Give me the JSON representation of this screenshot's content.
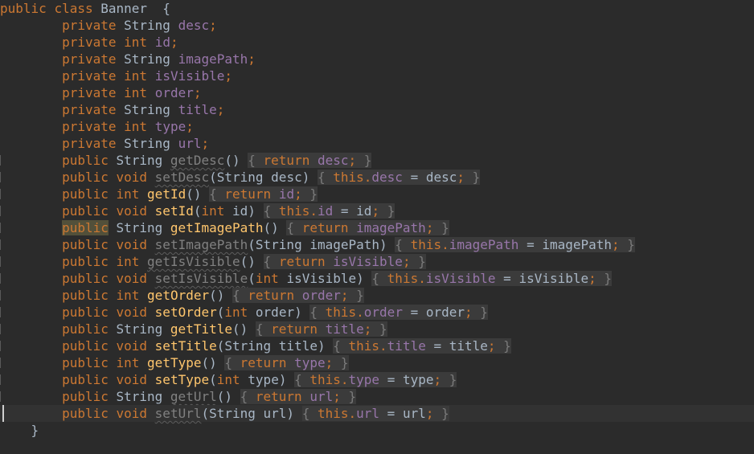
{
  "editor": {
    "lines": [
      {
        "indent": "",
        "tokens": [
          [
            "kw",
            "public"
          ],
          [
            "p",
            " "
          ],
          [
            "kw",
            "class"
          ],
          [
            "p",
            " Banner  {"
          ]
        ]
      },
      {
        "indent": "        ",
        "tokens": [
          [
            "kw",
            "private"
          ],
          [
            "p",
            " String "
          ],
          [
            "field",
            "desc"
          ],
          [
            "kw",
            ";"
          ]
        ]
      },
      {
        "indent": "        ",
        "tokens": [
          [
            "kw",
            "private"
          ],
          [
            "p",
            " "
          ],
          [
            "kw",
            "int"
          ],
          [
            "p",
            " "
          ],
          [
            "field",
            "id"
          ],
          [
            "kw",
            ";"
          ]
        ]
      },
      {
        "indent": "        ",
        "tokens": [
          [
            "kw",
            "private"
          ],
          [
            "p",
            " String "
          ],
          [
            "field",
            "imagePath"
          ],
          [
            "kw",
            ";"
          ]
        ]
      },
      {
        "indent": "        ",
        "tokens": [
          [
            "kw",
            "private"
          ],
          [
            "p",
            " "
          ],
          [
            "kw",
            "int"
          ],
          [
            "p",
            " "
          ],
          [
            "field",
            "isVisible"
          ],
          [
            "kw",
            ";"
          ]
        ]
      },
      {
        "indent": "        ",
        "tokens": [
          [
            "kw",
            "private"
          ],
          [
            "p",
            " "
          ],
          [
            "kw",
            "int"
          ],
          [
            "p",
            " "
          ],
          [
            "field",
            "order"
          ],
          [
            "kw",
            ";"
          ]
        ]
      },
      {
        "indent": "        ",
        "tokens": [
          [
            "kw",
            "private"
          ],
          [
            "p",
            " String "
          ],
          [
            "field",
            "title"
          ],
          [
            "kw",
            ";"
          ]
        ]
      },
      {
        "indent": "        ",
        "tokens": [
          [
            "kw",
            "private"
          ],
          [
            "p",
            " "
          ],
          [
            "kw",
            "int"
          ],
          [
            "p",
            " "
          ],
          [
            "field",
            "type"
          ],
          [
            "kw",
            ";"
          ]
        ]
      },
      {
        "indent": "        ",
        "tokens": [
          [
            "kw",
            "private"
          ],
          [
            "p",
            " String "
          ],
          [
            "field",
            "url"
          ],
          [
            "kw",
            ";"
          ]
        ]
      },
      {
        "indent": "        ",
        "tick": true,
        "tokens": [
          [
            "kw",
            "public"
          ],
          [
            "p",
            " String "
          ],
          [
            "unused",
            "getDesc"
          ],
          [
            "p",
            "() "
          ],
          [
            "foldp",
            "{ "
          ],
          [
            "foldk",
            "return"
          ],
          [
            "foldf",
            " desc"
          ],
          [
            "foldk",
            ";"
          ],
          [
            "foldp",
            " }"
          ]
        ]
      },
      {
        "indent": "        ",
        "tick": true,
        "tokens": [
          [
            "kw",
            "public"
          ],
          [
            "p",
            " "
          ],
          [
            "kw",
            "void"
          ],
          [
            "p",
            " "
          ],
          [
            "unused",
            "setDesc"
          ],
          [
            "p",
            "(String desc) "
          ],
          [
            "foldp",
            "{ "
          ],
          [
            "foldk",
            "this"
          ],
          [
            "foldk",
            "."
          ],
          [
            "foldf",
            "desc"
          ],
          [
            "foldt",
            " = desc"
          ],
          [
            "foldk",
            ";"
          ],
          [
            "foldp",
            " }"
          ]
        ]
      },
      {
        "indent": "        ",
        "tick": true,
        "tokens": [
          [
            "kw",
            "public"
          ],
          [
            "p",
            " "
          ],
          [
            "kw",
            "int"
          ],
          [
            "p",
            " "
          ],
          [
            "fn",
            "getId"
          ],
          [
            "p",
            "() "
          ],
          [
            "foldp",
            "{ "
          ],
          [
            "foldk",
            "return"
          ],
          [
            "foldf",
            " id"
          ],
          [
            "foldk",
            ";"
          ],
          [
            "foldp",
            " }"
          ]
        ]
      },
      {
        "indent": "        ",
        "tick": true,
        "tokens": [
          [
            "kw",
            "public"
          ],
          [
            "p",
            " "
          ],
          [
            "kw",
            "void"
          ],
          [
            "p",
            " "
          ],
          [
            "fn",
            "setId"
          ],
          [
            "p",
            "("
          ],
          [
            "kw",
            "int"
          ],
          [
            "p",
            " id) "
          ],
          [
            "foldp",
            "{ "
          ],
          [
            "foldk",
            "this"
          ],
          [
            "foldk",
            "."
          ],
          [
            "foldf",
            "id"
          ],
          [
            "foldt",
            " = id"
          ],
          [
            "foldk",
            ";"
          ],
          [
            "foldp",
            " }"
          ]
        ]
      },
      {
        "indent": "        ",
        "tick": true,
        "tokens": [
          [
            "kwhl",
            "public"
          ],
          [
            "p",
            " String "
          ],
          [
            "fn",
            "getImagePath"
          ],
          [
            "p",
            "() "
          ],
          [
            "foldp",
            "{ "
          ],
          [
            "foldk",
            "return"
          ],
          [
            "foldf",
            " imagePath"
          ],
          [
            "foldk",
            ";"
          ],
          [
            "foldp",
            " }"
          ]
        ]
      },
      {
        "indent": "        ",
        "tick": true,
        "tokens": [
          [
            "kw",
            "public"
          ],
          [
            "p",
            " "
          ],
          [
            "kw",
            "void"
          ],
          [
            "p",
            " "
          ],
          [
            "unused",
            "setImagePath"
          ],
          [
            "p",
            "(String imagePath) "
          ],
          [
            "foldp",
            "{ "
          ],
          [
            "foldk",
            "this"
          ],
          [
            "foldk",
            "."
          ],
          [
            "foldf",
            "imagePath"
          ],
          [
            "foldt",
            " = imagePath"
          ],
          [
            "foldk",
            ";"
          ],
          [
            "foldp",
            " }"
          ]
        ]
      },
      {
        "indent": "        ",
        "tick": true,
        "tokens": [
          [
            "kw",
            "public"
          ],
          [
            "p",
            " "
          ],
          [
            "kw",
            "int"
          ],
          [
            "p",
            " "
          ],
          [
            "unused",
            "getIsVisible"
          ],
          [
            "p",
            "() "
          ],
          [
            "foldp",
            "{ "
          ],
          [
            "foldk",
            "return"
          ],
          [
            "foldf",
            " isVisible"
          ],
          [
            "foldk",
            ";"
          ],
          [
            "foldp",
            " }"
          ]
        ]
      },
      {
        "indent": "        ",
        "tick": true,
        "tokens": [
          [
            "kw",
            "public"
          ],
          [
            "p",
            " "
          ],
          [
            "kw",
            "void"
          ],
          [
            "p",
            " "
          ],
          [
            "unused",
            "setIsVisible"
          ],
          [
            "p",
            "("
          ],
          [
            "kw",
            "int"
          ],
          [
            "p",
            " isVisible) "
          ],
          [
            "foldp",
            "{ "
          ],
          [
            "foldk",
            "this"
          ],
          [
            "foldk",
            "."
          ],
          [
            "foldf",
            "isVisible"
          ],
          [
            "foldt",
            " = isVisible"
          ],
          [
            "foldk",
            ";"
          ],
          [
            "foldp",
            " }"
          ]
        ]
      },
      {
        "indent": "        ",
        "tick": true,
        "tokens": [
          [
            "kw",
            "public"
          ],
          [
            "p",
            " "
          ],
          [
            "kw",
            "int"
          ],
          [
            "p",
            " "
          ],
          [
            "fn",
            "getOrder"
          ],
          [
            "p",
            "() "
          ],
          [
            "foldp",
            "{ "
          ],
          [
            "foldk",
            "return"
          ],
          [
            "foldf",
            " order"
          ],
          [
            "foldk",
            ";"
          ],
          [
            "foldp",
            " }"
          ]
        ]
      },
      {
        "indent": "        ",
        "tick": true,
        "tokens": [
          [
            "kw",
            "public"
          ],
          [
            "p",
            " "
          ],
          [
            "kw",
            "void"
          ],
          [
            "p",
            " "
          ],
          [
            "fn",
            "setOrder"
          ],
          [
            "p",
            "("
          ],
          [
            "kw",
            "int"
          ],
          [
            "p",
            " order) "
          ],
          [
            "foldp",
            "{ "
          ],
          [
            "foldk",
            "this"
          ],
          [
            "foldk",
            "."
          ],
          [
            "foldf",
            "order"
          ],
          [
            "foldt",
            " = order"
          ],
          [
            "foldk",
            ";"
          ],
          [
            "foldp",
            " }"
          ]
        ]
      },
      {
        "indent": "        ",
        "tick": true,
        "tokens": [
          [
            "kw",
            "public"
          ],
          [
            "p",
            " String "
          ],
          [
            "fn",
            "getTitle"
          ],
          [
            "p",
            "() "
          ],
          [
            "foldp",
            "{ "
          ],
          [
            "foldk",
            "return"
          ],
          [
            "foldf",
            " title"
          ],
          [
            "foldk",
            ";"
          ],
          [
            "foldp",
            " }"
          ]
        ]
      },
      {
        "indent": "        ",
        "tick": true,
        "tokens": [
          [
            "kw",
            "public"
          ],
          [
            "p",
            " "
          ],
          [
            "kw",
            "void"
          ],
          [
            "p",
            " "
          ],
          [
            "fn",
            "setTitle"
          ],
          [
            "p",
            "(String title) "
          ],
          [
            "foldp",
            "{ "
          ],
          [
            "foldk",
            "this"
          ],
          [
            "foldk",
            "."
          ],
          [
            "foldf",
            "title"
          ],
          [
            "foldt",
            " = title"
          ],
          [
            "foldk",
            ";"
          ],
          [
            "foldp",
            " }"
          ]
        ]
      },
      {
        "indent": "        ",
        "tick": true,
        "tokens": [
          [
            "kw",
            "public"
          ],
          [
            "p",
            " "
          ],
          [
            "kw",
            "int"
          ],
          [
            "p",
            " "
          ],
          [
            "fn",
            "getType"
          ],
          [
            "p",
            "() "
          ],
          [
            "foldp",
            "{ "
          ],
          [
            "foldk",
            "return"
          ],
          [
            "foldf",
            " type"
          ],
          [
            "foldk",
            ";"
          ],
          [
            "foldp",
            " }"
          ]
        ]
      },
      {
        "indent": "        ",
        "tick": true,
        "tokens": [
          [
            "kw",
            "public"
          ],
          [
            "p",
            " "
          ],
          [
            "kw",
            "void"
          ],
          [
            "p",
            " "
          ],
          [
            "fn",
            "setType"
          ],
          [
            "p",
            "("
          ],
          [
            "kw",
            "int"
          ],
          [
            "p",
            " type) "
          ],
          [
            "foldp",
            "{ "
          ],
          [
            "foldk",
            "this"
          ],
          [
            "foldk",
            "."
          ],
          [
            "foldf",
            "type"
          ],
          [
            "foldt",
            " = type"
          ],
          [
            "foldk",
            ";"
          ],
          [
            "foldp",
            " }"
          ]
        ]
      },
      {
        "indent": "        ",
        "tick": true,
        "tokens": [
          [
            "kw",
            "public"
          ],
          [
            "p",
            " String "
          ],
          [
            "unused",
            "getUrl"
          ],
          [
            "p",
            "() "
          ],
          [
            "foldp",
            "{ "
          ],
          [
            "foldk",
            "return"
          ],
          [
            "foldf",
            " url"
          ],
          [
            "foldk",
            ";"
          ],
          [
            "foldp",
            " }"
          ]
        ]
      },
      {
        "indent": "        ",
        "current": true,
        "caret": true,
        "tokens": [
          [
            "kw",
            "public"
          ],
          [
            "p",
            " "
          ],
          [
            "kw",
            "void"
          ],
          [
            "p",
            " "
          ],
          [
            "unused",
            "setUrl"
          ],
          [
            "p",
            "(String url) "
          ],
          [
            "foldp",
            "{ "
          ],
          [
            "foldk",
            "this"
          ],
          [
            "foldk",
            "."
          ],
          [
            "foldf",
            "url"
          ],
          [
            "foldt",
            " = url"
          ],
          [
            "foldk",
            ";"
          ],
          [
            "foldp",
            " }"
          ]
        ]
      },
      {
        "indent": "    ",
        "tokens": [
          [
            "p",
            "}"
          ]
        ]
      }
    ],
    "colors": {
      "background": "#2b2b2b",
      "current_line": "#323232",
      "keyword": "#cc7832",
      "field": "#9876aa",
      "method": "#ffc66d",
      "text": "#a9b7c6",
      "unused": "#808080",
      "fold_bg": "#3b3b3b"
    }
  }
}
